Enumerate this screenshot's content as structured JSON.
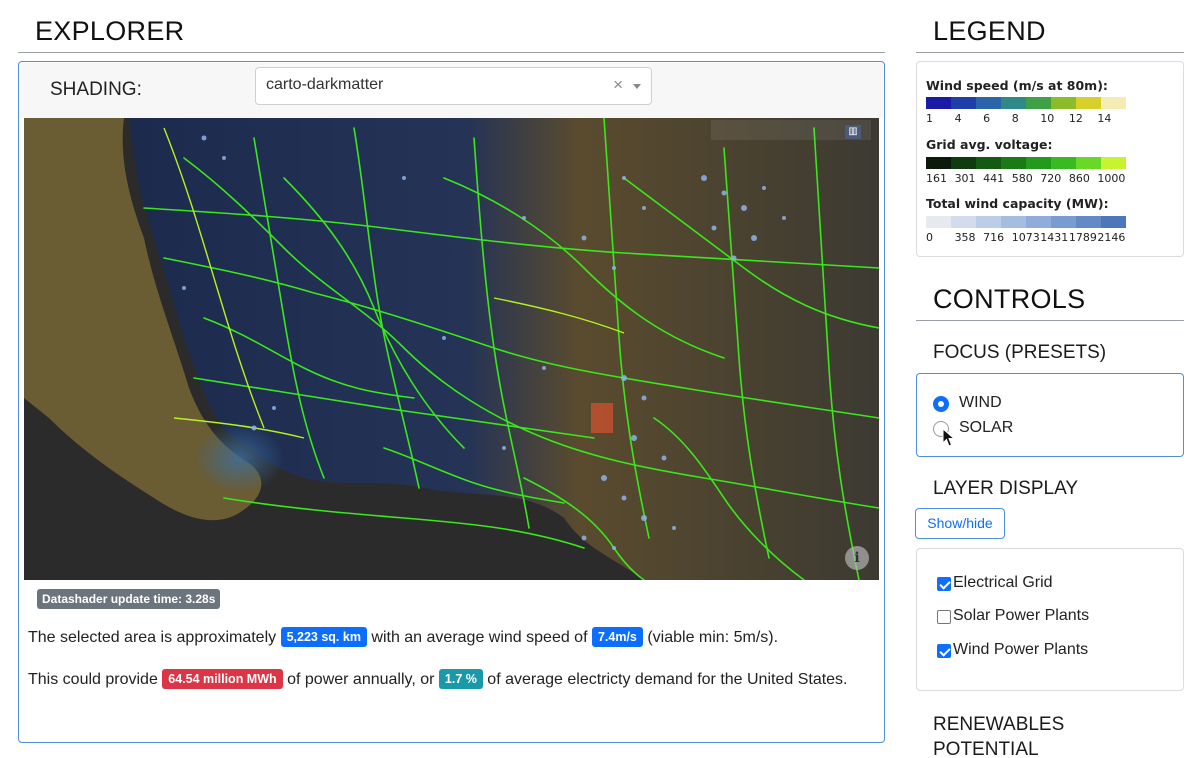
{
  "explorer": {
    "title": "EXPLORER",
    "shading_label": "SHADING:",
    "shading_value": "carto-darkmatter",
    "clear_glyph": "×",
    "update_badge": "Datashader update time: 3.28s",
    "summary": {
      "p1_a": "The selected area is approximately ",
      "area": "5,223 sq. km",
      "p1_b": " with an average wind speed of ",
      "wind": "7.4m/s",
      "p1_c": " (viable min: 5m/s).",
      "p2_a": "This could provide ",
      "power": "64.54 million MWh",
      "p2_b": " of power annually, or ",
      "pct": "1.7 %",
      "p2_c": " of average electricty demand for the United States."
    },
    "map": {
      "info_glyph": "i",
      "toolbar_icon": "bar-chart-icon",
      "colors": {
        "ocean": "#2b2b2b",
        "land": "#5c5030",
        "coast": "#6a5c33",
        "grid": "#39e81a",
        "grid_bright": "#b6f21e",
        "wind": "#8fb3e8"
      }
    }
  },
  "legend": {
    "title": "LEGEND",
    "wind_speed": {
      "title": "Wind speed (m/s at 80m):",
      "colors": [
        "#1a1aa6",
        "#1e3ea8",
        "#2c64aa",
        "#2e8a86",
        "#3fa046",
        "#8cbc2a",
        "#d8d02a",
        "#f3ecb4"
      ],
      "ticks": [
        "1",
        "4",
        "6",
        "8",
        "10",
        "12",
        "14"
      ]
    },
    "voltage": {
      "title": "Grid avg. voltage:",
      "colors": [
        "#0c1a0c",
        "#103a10",
        "#155a12",
        "#1b7a16",
        "#249a1c",
        "#3aba22",
        "#6ad826",
        "#c6f430"
      ],
      "ticks": [
        "161",
        "301",
        "441",
        "580",
        "720",
        "860",
        "1000"
      ]
    },
    "capacity": {
      "title": "Total wind capacity (MW):",
      "colors": [
        "#e6e9ef",
        "#d2dcec",
        "#bccde8",
        "#a6bde2",
        "#8facda",
        "#799bd0",
        "#638ac6",
        "#4c78bb"
      ],
      "ticks": [
        "0",
        "358",
        "716",
        "1073",
        "1431",
        "1789",
        "2146"
      ]
    }
  },
  "controls": {
    "title": "CONTROLS",
    "focus_title": "FOCUS (PRESETS)",
    "focus_options": [
      {
        "label": "WIND",
        "selected": true
      },
      {
        "label": "SOLAR",
        "selected": false
      }
    ],
    "layer_title": "LAYER DISPLAY",
    "showhide_label": "Show/hide",
    "layers": [
      {
        "label": "Electrical Grid",
        "checked": true
      },
      {
        "label": "Solar Power Plants",
        "checked": false
      },
      {
        "label": "Wind Power Plants",
        "checked": true
      }
    ],
    "renewables_line1": "RENEWABLES",
    "renewables_line2": "POTENTIAL"
  }
}
